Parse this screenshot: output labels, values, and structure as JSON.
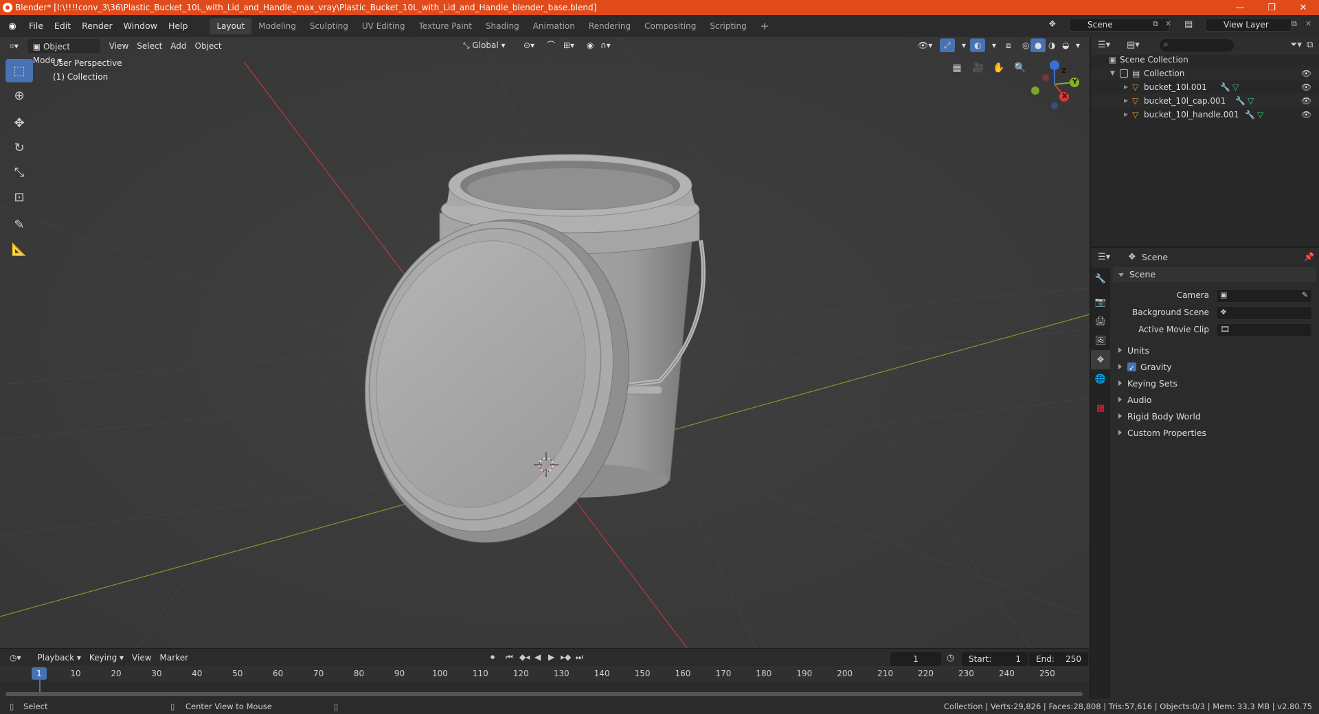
{
  "window": {
    "title": "Blender* [I:\\!!!!conv_3\\36\\Plastic_Bucket_10L_with_Lid_and_Handle_max_vray\\Plastic_Bucket_10L_with_Lid_and_Handle_blender_base.blend]",
    "minimize": "—",
    "maximize": "❐",
    "close": "✕"
  },
  "menu": [
    "File",
    "Edit",
    "Render",
    "Window",
    "Help"
  ],
  "workspaces": [
    "Layout",
    "Modeling",
    "Sculpting",
    "UV Editing",
    "Texture Paint",
    "Shading",
    "Animation",
    "Rendering",
    "Compositing",
    "Scripting"
  ],
  "active_workspace": "Layout",
  "add_workspace": "+",
  "scene_field": "Scene",
  "view_layer_field": "View Layer",
  "viewport": {
    "mode": "Object Mode",
    "menus": [
      "View",
      "Select",
      "Add",
      "Object"
    ],
    "orientation": "Global",
    "perspective_label": "User Perspective",
    "collection_label": "(1) Collection",
    "gizmo": {
      "x": "X",
      "y": "Y",
      "z": "Z"
    }
  },
  "outliner": {
    "root": "Scene Collection",
    "collection": "Collection",
    "objects": [
      "bucket_10l.001",
      "bucket_10l_cap.001",
      "bucket_10l_handle.001"
    ]
  },
  "properties": {
    "header": "Scene",
    "panel": "Scene",
    "camera_label": "Camera",
    "background_scene_label": "Background Scene",
    "active_movie_clip_label": "Active Movie Clip",
    "subpanels": [
      "Units",
      "Gravity",
      "Keying Sets",
      "Audio",
      "Rigid Body World",
      "Custom Properties"
    ],
    "gravity_enabled": true
  },
  "timeline": {
    "menus": [
      "Playback",
      "Keying",
      "View",
      "Marker"
    ],
    "current_frame": "1",
    "start_label": "Start:",
    "start": "1",
    "end_label": "End:",
    "end": "250",
    "ruler": [
      "1",
      "10",
      "20",
      "30",
      "40",
      "50",
      "60",
      "70",
      "80",
      "90",
      "100",
      "110",
      "120",
      "130",
      "140",
      "150",
      "160",
      "170",
      "180",
      "190",
      "200",
      "210",
      "220",
      "230",
      "240",
      "250"
    ]
  },
  "statusbar": {
    "left": "Select",
    "middle": "Center View to Mouse",
    "right": "Collection | Verts:29,826 | Faces:28,808 | Tris:57,616 | Objects:0/3 | Mem: 33.3 MB | v2.80.75"
  },
  "colors": {
    "title_bar": "#e14b1b",
    "accent": "#4772b3",
    "x_axis": "#c0393b",
    "y_axis": "#7a9b2a",
    "object_icon": "#e8963a",
    "modifier_icon": "#6ea6e0",
    "mesh_icon": "#30c48a"
  }
}
